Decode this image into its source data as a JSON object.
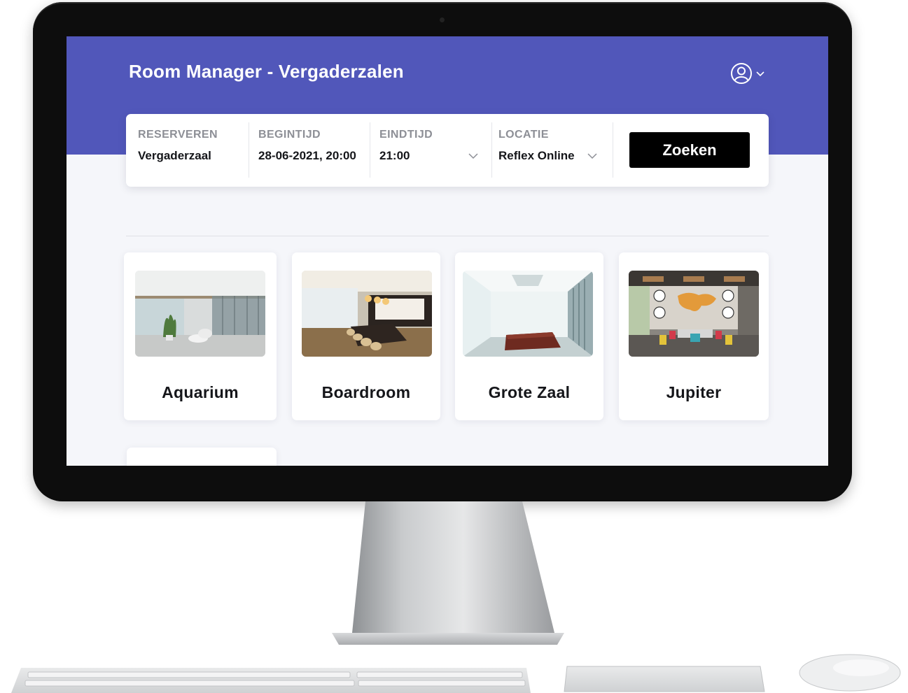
{
  "header": {
    "title": "Room Manager - Vergaderzalen",
    "user_icon": "user-circle-icon"
  },
  "search": {
    "fields": [
      {
        "label": "RESERVEREN",
        "value": "Vergaderzaal"
      },
      {
        "label": "BEGINTIJD",
        "value": "28-06-2021, 20:00"
      },
      {
        "label": "EINDTIJD",
        "value": "21:00"
      },
      {
        "label": "LOCATIE",
        "value": "Reflex Online"
      }
    ],
    "button_label": "Zoeken"
  },
  "rooms": [
    {
      "name": "Aquarium"
    },
    {
      "name": "Boardroom"
    },
    {
      "name": "Grote Zaal"
    },
    {
      "name": "Jupiter"
    }
  ],
  "colors": {
    "header": "#5157ba",
    "button": "#000000",
    "screen_background": "#f5f6fa"
  }
}
